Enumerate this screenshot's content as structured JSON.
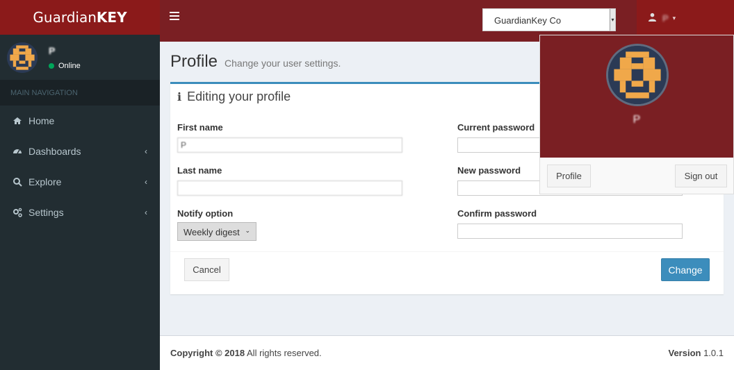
{
  "app": {
    "logo_light": "Guardian",
    "logo_bold": "KEY"
  },
  "sidebar": {
    "user_name": "P",
    "status": "Online",
    "nav_header": "MAIN NAVIGATION",
    "items": [
      {
        "label": "Home",
        "icon": "home-icon"
      },
      {
        "label": "Dashboards",
        "icon": "dashboard-icon"
      },
      {
        "label": "Explore",
        "icon": "search-icon"
      },
      {
        "label": "Settings",
        "icon": "gear-icon"
      }
    ]
  },
  "topbar": {
    "org_selected": "GuardianKey Co",
    "user_name": "P"
  },
  "page": {
    "title": "Profile",
    "subtitle": "Change your user settings."
  },
  "form": {
    "title": "Editing your profile",
    "first_name_label": "First name",
    "first_name_value": "P",
    "last_name_label": "Last name",
    "last_name_value": "",
    "notify_label": "Notify option",
    "notify_value": "Weekly digest",
    "current_password_label": "Current password",
    "new_password_label": "New password",
    "confirm_password_label": "Confirm password",
    "cancel_label": "Cancel",
    "change_label": "Change"
  },
  "user_dropdown": {
    "name": "P",
    "profile_label": "Profile",
    "signout_label": "Sign out"
  },
  "footer": {
    "copyright": "Copyright © 2018",
    "rights": " All rights reserved.",
    "version_label": "Version",
    "version_value": " 1.0.1"
  },
  "colors": {
    "brand": "#8b1a1a",
    "topbar": "#7a1f23",
    "sidebar": "#222d32",
    "accent": "#3c8dbc"
  }
}
